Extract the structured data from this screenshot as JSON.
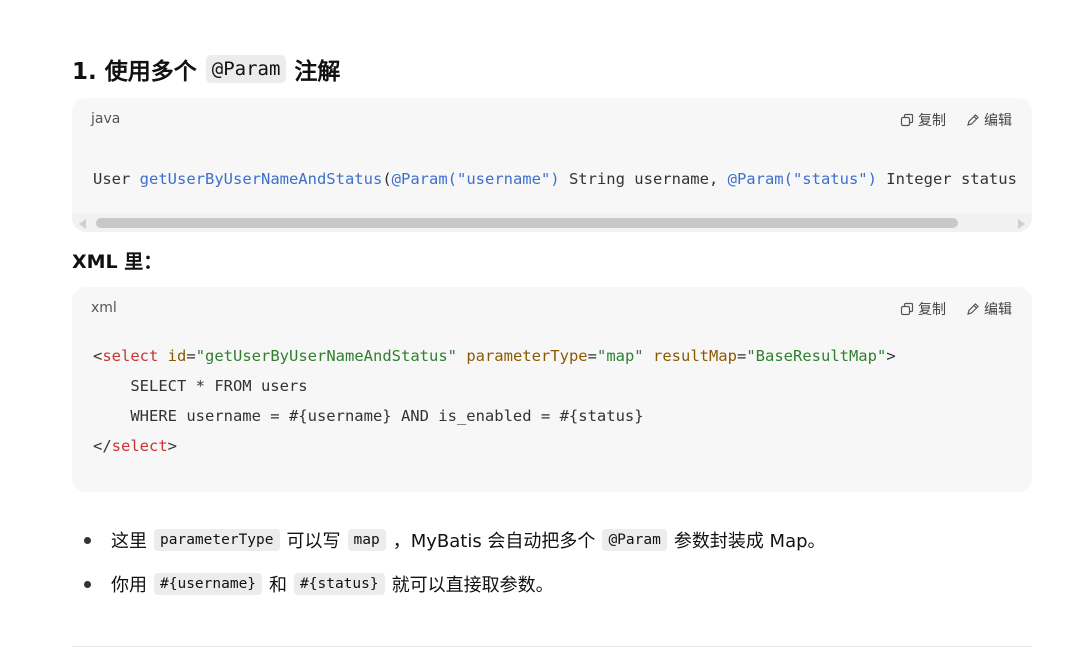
{
  "heading": {
    "prefix": "1. 使用多个",
    "code": "@Param",
    "suffix": "注解"
  },
  "java_block": {
    "lang": "java",
    "copy_label": "复制",
    "edit_label": "编辑",
    "tokens": {
      "t1": "User ",
      "t2": "getUserByUserNameAndStatus",
      "t3": "(",
      "t4": "@Param",
      "t5": "(\"username\")",
      "t6": " String username, ",
      "t7": "@Param",
      "t8": "(\"status\")",
      "t9": " Integer status"
    }
  },
  "xml_heading": "XML 里：",
  "xml_block": {
    "lang": "xml",
    "copy_label": "复制",
    "edit_label": "编辑",
    "line1": {
      "open": "<",
      "tag": "select",
      "attr1": " id",
      "eq1": "=",
      "val1": "\"getUserByUserNameAndStatus\"",
      "attr2": " parameterType",
      "eq2": "=",
      "val2": "\"map\"",
      "attr3": " resultMap",
      "eq3": "=",
      "val3": "\"BaseResultMap\"",
      "close": ">"
    },
    "line2": "    SELECT * FROM users",
    "line3": "    WHERE username = #{username} AND is_enabled = #{status}",
    "line4": {
      "open": "</",
      "tag": "select",
      "close": ">"
    }
  },
  "bullets": [
    {
      "p1": "这里",
      "c1": "parameterType",
      "p2": "可以写",
      "c2": "map",
      "p3": "，MyBatis 会自动把多个",
      "c3": "@Param",
      "p4": "参数封装成 Map。"
    },
    {
      "p1": "你用",
      "c1": "#{username}",
      "p2": "和",
      "c2": "#{status}",
      "p3": "就可以直接取参数。"
    }
  ]
}
